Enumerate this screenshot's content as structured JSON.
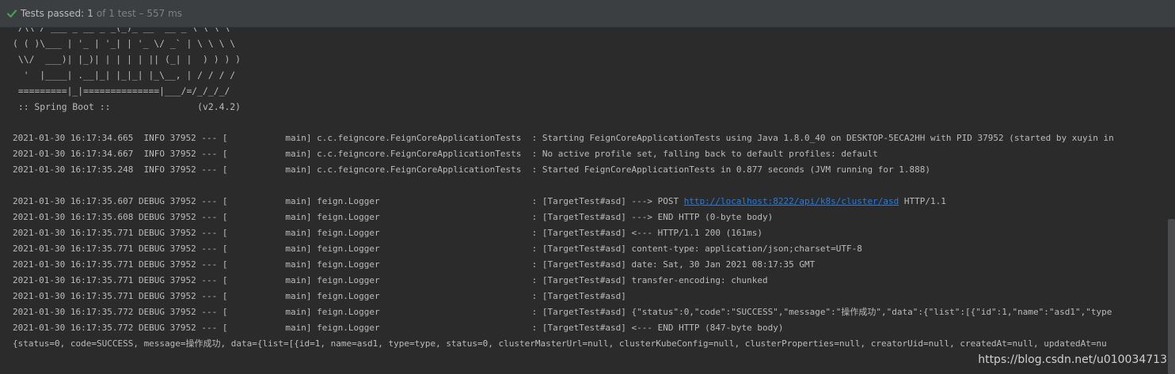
{
  "status": {
    "label": "Tests passed:",
    "count": "1",
    "detail": "of 1 test – 557 ms",
    "check_color": "#499c54"
  },
  "banner": [
    " /\\\\ / ___'_ __ _ _(_)_ __  __ _ \\ \\ \\ \\",
    "( ( )\\___ | '_ | '_| | '_ \\/ _` | \\ \\ \\ \\",
    " \\\\/  ___)| |_)| | | | | || (_| |  ) ) ) )",
    "  '  |____| .__|_| |_|_| |_\\__, | / / / /",
    " =========|_|==============|___/=/_/_/_/",
    " :: Spring Boot ::                (v2.4.2)"
  ],
  "log_lines": [
    "2021-01-30 16:17:34.665  INFO 37952 --- [           main] c.c.feigncore.FeignCoreApplicationTests  : Starting FeignCoreApplicationTests using Java 1.8.0_40 on DESKTOP-5ECA2HH with PID 37952 (started by xuyin in",
    "2021-01-30 16:17:34.667  INFO 37952 --- [           main] c.c.feigncore.FeignCoreApplicationTests  : No active profile set, falling back to default profiles: default",
    "2021-01-30 16:17:35.248  INFO 37952 --- [           main] c.c.feigncore.FeignCoreApplicationTests  : Started FeignCoreApplicationTests in 0.877 seconds (JVM running for 1.888)"
  ],
  "debug_post": {
    "prefix": "2021-01-30 16:17:35.607 DEBUG 37952 --- [           main] feign.Logger                             : [TargetTest#asd] ---> POST ",
    "url": "http://localhost:8222/api/k8s/cluster/asd",
    "suffix": " HTTP/1.1"
  },
  "debug_lines": [
    "2021-01-30 16:17:35.608 DEBUG 37952 --- [           main] feign.Logger                             : [TargetTest#asd] ---> END HTTP (0-byte body)",
    "2021-01-30 16:17:35.771 DEBUG 37952 --- [           main] feign.Logger                             : [TargetTest#asd] <--- HTTP/1.1 200 (161ms)",
    "2021-01-30 16:17:35.771 DEBUG 37952 --- [           main] feign.Logger                             : [TargetTest#asd] content-type: application/json;charset=UTF-8",
    "2021-01-30 16:17:35.771 DEBUG 37952 --- [           main] feign.Logger                             : [TargetTest#asd] date: Sat, 30 Jan 2021 08:17:35 GMT",
    "2021-01-30 16:17:35.771 DEBUG 37952 --- [           main] feign.Logger                             : [TargetTest#asd] transfer-encoding: chunked",
    "2021-01-30 16:17:35.771 DEBUG 37952 --- [           main] feign.Logger                             : [TargetTest#asd]",
    "2021-01-30 16:17:35.772 DEBUG 37952 --- [           main] feign.Logger                             : [TargetTest#asd] {\"status\":0,\"code\":\"SUCCESS\",\"message\":\"操作成功\",\"data\":{\"list\":[{\"id\":1,\"name\":\"asd1\",\"type",
    "2021-01-30 16:17:35.772 DEBUG 37952 --- [           main] feign.Logger                             : [TargetTest#asd] <--- END HTTP (847-byte body)"
  ],
  "result_line": "{status=0, code=SUCCESS, message=操作成功, data={list=[{id=1, name=asd1, type=type, status=0, clusterMasterUrl=null, clusterKubeConfig=null, clusterProperties=null, creatorUid=null, createdAt=null, updatedAt=nu",
  "watermark": "https://blog.csdn.net/u010034713"
}
